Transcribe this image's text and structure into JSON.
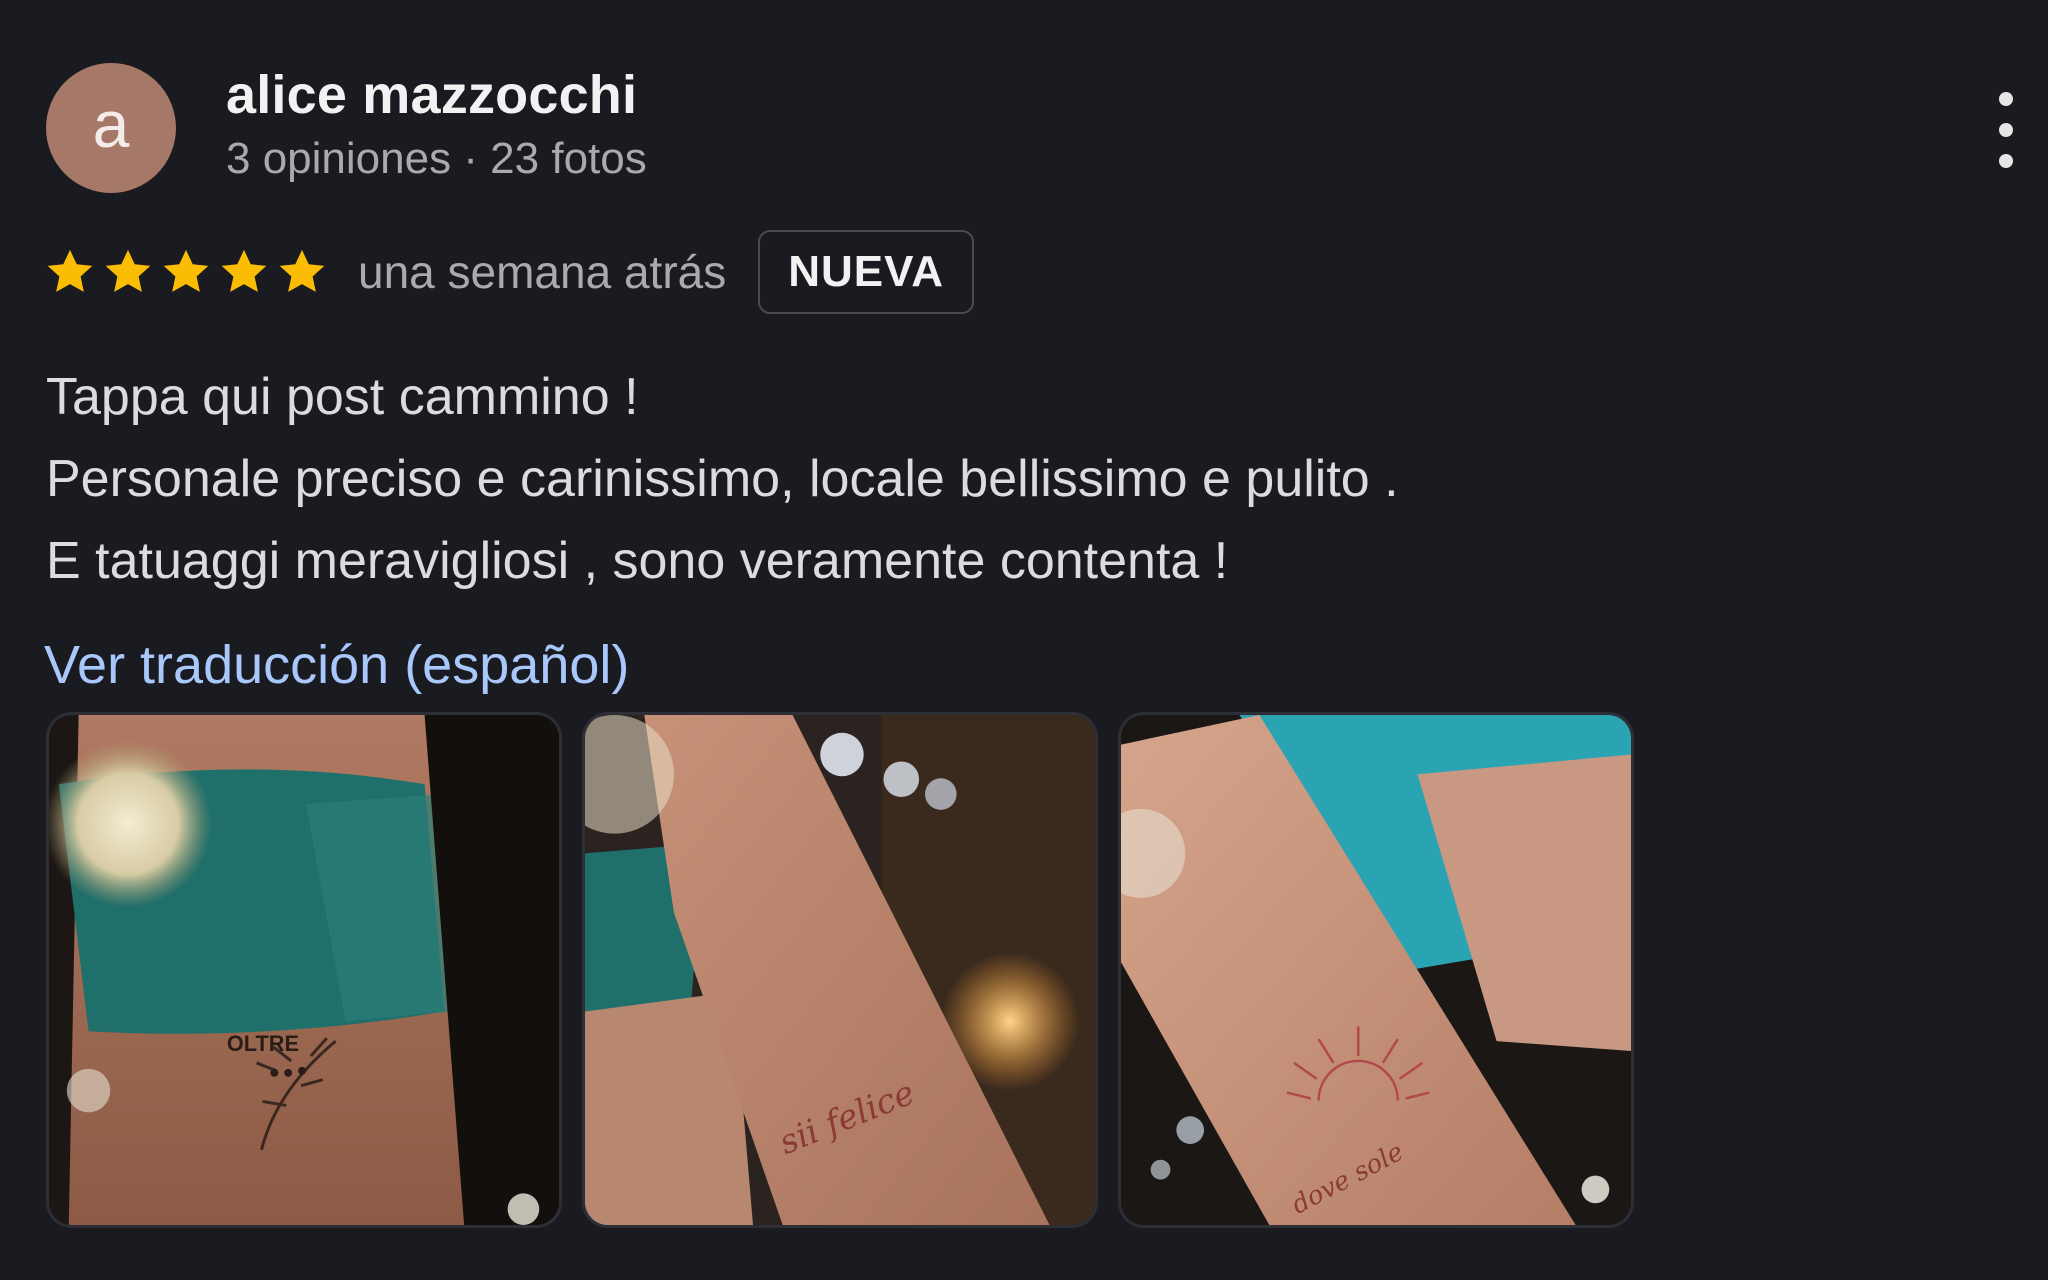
{
  "reviewer": {
    "initial": "a",
    "name": "alice mazzocchi",
    "meta": "3 opiniones · 23 fotos"
  },
  "review": {
    "rating": 5,
    "max_rating": 5,
    "date": "una semana atrás",
    "badge": "NUEVA",
    "lines": [
      "Tappa qui post cammino !",
      "Personale preciso e carinissimo, locale bellissimo e pulito .",
      "E tatuaggi meravigliosi , sono veramente contenta !"
    ],
    "translate_link": "Ver traducción (español)"
  },
  "photos": [
    {
      "icon": "tattoo-photo-leaf"
    },
    {
      "icon": "tattoo-photo-script"
    },
    {
      "icon": "tattoo-photo-sun"
    }
  ],
  "icons": {
    "star": "star-icon",
    "more": "more-vertical-icon"
  },
  "colors": {
    "background": "#1a1b21",
    "star": "#fbbc04",
    "avatar": "#a57868",
    "link": "#a8c7fa"
  }
}
